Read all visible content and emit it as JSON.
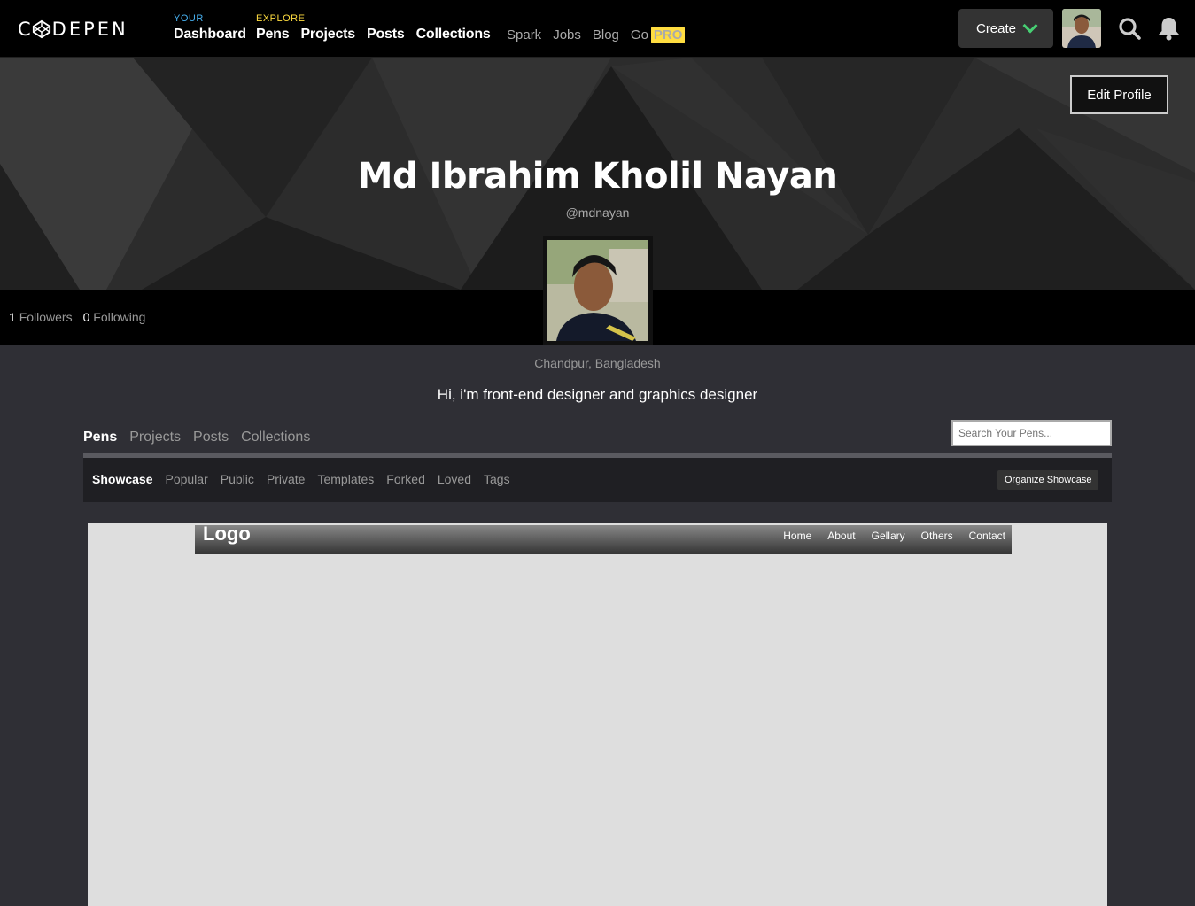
{
  "header": {
    "logo_text": "CODEPEN",
    "your_label": "YOUR",
    "your_links": [
      "Dashboard"
    ],
    "explore_label": "EXPLORE",
    "explore_links": [
      "Pens",
      "Projects",
      "Posts",
      "Collections"
    ],
    "secondary_links": [
      "Spark",
      "Jobs",
      "Blog",
      "Go"
    ],
    "pro_badge": "PRO",
    "create_label": "Create"
  },
  "profile": {
    "edit_label": "Edit Profile",
    "name": "Md Ibrahim Kholil Nayan",
    "handle": "@mdnayan",
    "followers_count": "1",
    "followers_label": "Followers",
    "following_count": "0",
    "following_label": "Following",
    "location": "Chandpur, Bangladesh",
    "bio": "Hi, i'm front-end designer and graphics designer"
  },
  "tabs": {
    "items": [
      "Pens",
      "Projects",
      "Posts",
      "Collections"
    ],
    "active": "Pens",
    "search_placeholder": "Search Your Pens..."
  },
  "subnav": {
    "items": [
      "Showcase",
      "Popular",
      "Public",
      "Private",
      "Templates",
      "Forked",
      "Loved",
      "Tags"
    ],
    "active": "Showcase",
    "organize_label": "Organize Showcase"
  },
  "preview": {
    "logo": "Logo",
    "nav": [
      "Home",
      "About",
      "Gellary",
      "Others",
      "Contact"
    ]
  },
  "colors": {
    "accent_green": "#47cf73",
    "your_blue": "#47b0f0",
    "explore_yellow": "#ffdd40"
  }
}
